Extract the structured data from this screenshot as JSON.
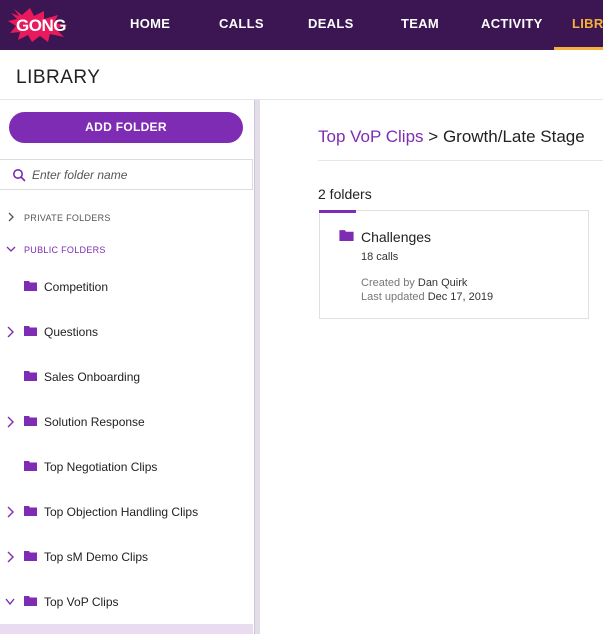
{
  "colors": {
    "nav_bg": "#3b1653",
    "accent": "#7e2cb3",
    "active_tab": "#f5b13a",
    "logo": "#e8195c"
  },
  "nav": {
    "logo_text": "GONG",
    "items": [
      {
        "label": "HOME"
      },
      {
        "label": "CALLS"
      },
      {
        "label": "DEALS"
      },
      {
        "label": "TEAM"
      },
      {
        "label": "ACTIVITY"
      },
      {
        "label": "LIBRARY",
        "active": true
      }
    ]
  },
  "page": {
    "title": "LIBRARY"
  },
  "sidebar": {
    "add_folder_label": "ADD FOLDER",
    "search_placeholder": "Enter folder name",
    "search_value": "",
    "sections": [
      {
        "label": "PRIVATE FOLDERS",
        "expanded": false
      },
      {
        "label": "PUBLIC FOLDERS",
        "expanded": true
      }
    ],
    "folders": [
      {
        "label": "Competition",
        "has_children": false,
        "expanded": false
      },
      {
        "label": "Questions",
        "has_children": true,
        "expanded": false
      },
      {
        "label": "Sales Onboarding",
        "has_children": false,
        "expanded": false
      },
      {
        "label": "Solution Response",
        "has_children": true,
        "expanded": false
      },
      {
        "label": "Top Negotiation Clips",
        "has_children": false,
        "expanded": false
      },
      {
        "label": "Top Objection Handling Clips",
        "has_children": true,
        "expanded": false
      },
      {
        "label": "Top sM Demo Clips",
        "has_children": true,
        "expanded": false
      },
      {
        "label": "Top VoP Clips",
        "has_children": true,
        "expanded": true
      }
    ]
  },
  "main": {
    "breadcrumb": {
      "parent": "Top VoP Clips",
      "separator": ">",
      "current": "Growth/Late Stage"
    },
    "folder_count": "2 folders",
    "cards": [
      {
        "title": "Challenges",
        "calls": "18 calls",
        "created_by_label": "Created by",
        "created_by": "Dan Quirk",
        "updated_label": "Last updated",
        "updated": "Dec 17, 2019"
      }
    ]
  }
}
